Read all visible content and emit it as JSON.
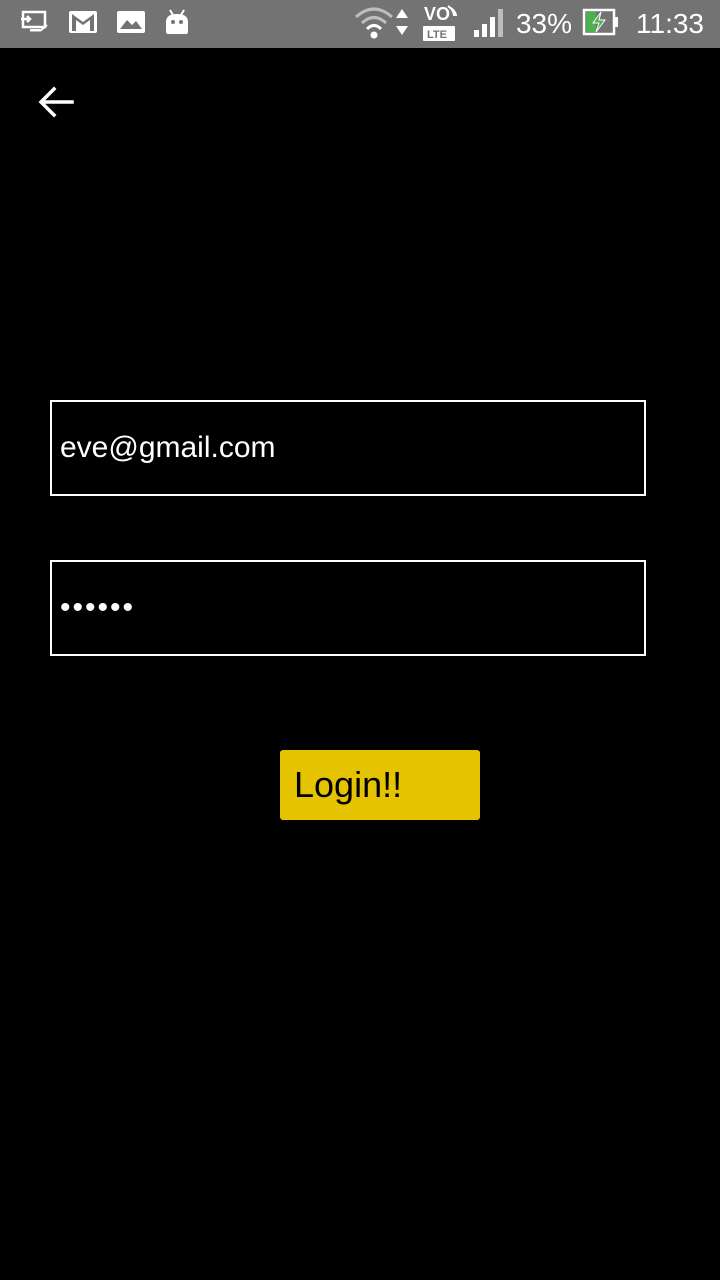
{
  "status_bar": {
    "battery_percent": "33%",
    "time": "11:33",
    "network_label_top": "VO",
    "network_label_bottom": "LTE",
    "icons": [
      "screen-cast-icon",
      "gmail-icon",
      "gallery-icon",
      "android-icon",
      "wifi-icon",
      "data-arrows-icon",
      "volte-icon",
      "signal-icon",
      "battery-charging-icon"
    ]
  },
  "nav": {
    "back_icon": "arrow-back-icon"
  },
  "form": {
    "email_value": "eve@gmail.com",
    "password_value": "••••••",
    "login_label": "Login!!"
  },
  "colors": {
    "background": "#000000",
    "status_bar": "#737373",
    "field_border": "#ffffff",
    "button": "#e6c300",
    "button_text": "#000000",
    "battery_bolt": "#4caf50"
  }
}
